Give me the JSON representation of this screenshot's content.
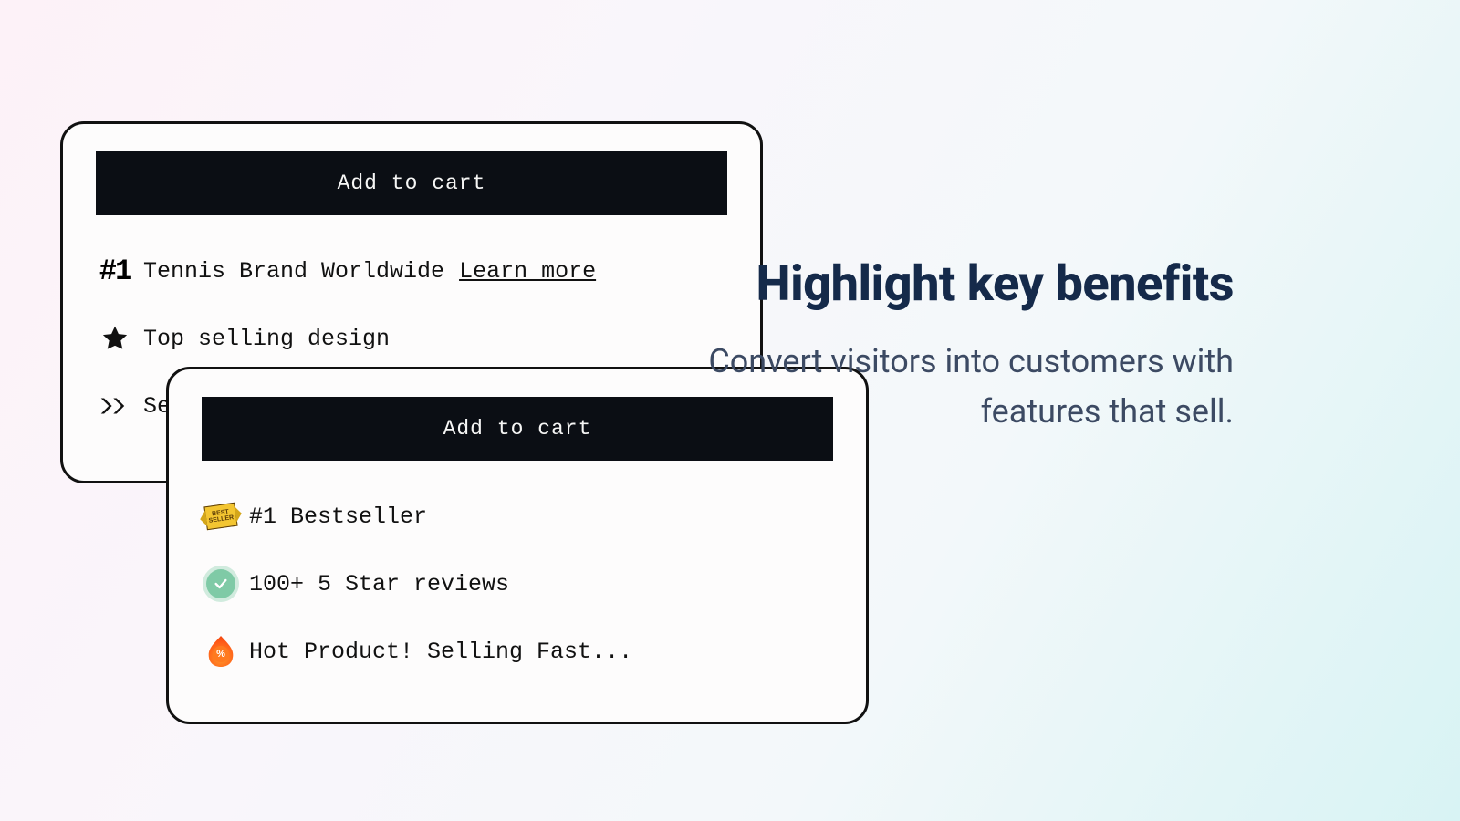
{
  "card_a": {
    "button_label": "Add to cart",
    "benefits": [
      {
        "text": "Tennis Brand Worldwide",
        "link_text": "Learn more"
      },
      {
        "text": "Top selling design"
      },
      {
        "text": "Se"
      }
    ]
  },
  "card_b": {
    "button_label": "Add to cart",
    "benefits": [
      {
        "text": "#1 Bestseller"
      },
      {
        "text": "100+ 5 Star reviews"
      },
      {
        "text": "Hot Product! Selling Fast..."
      }
    ]
  },
  "bestseller_badge": {
    "line1": "BEST",
    "line2": "SELLER"
  },
  "flame_pct_symbol": "%",
  "headline": "Highlight key benefits",
  "subhead": "Convert visitors into customers with features that sell."
}
